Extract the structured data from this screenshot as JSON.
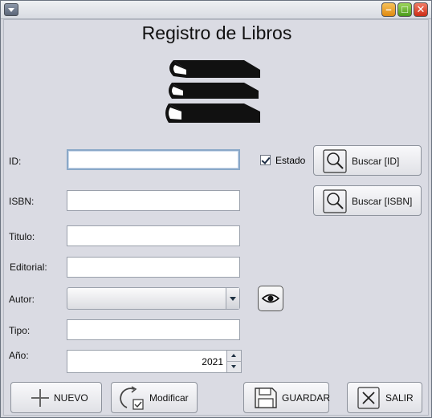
{
  "window": {
    "title": ""
  },
  "header": {
    "title": "Registro de Libros",
    "logo_icon": "books-icon"
  },
  "form": {
    "id": {
      "label": "ID:",
      "value": ""
    },
    "isbn": {
      "label": "ISBN:",
      "value": ""
    },
    "titulo": {
      "label": "Titulo:",
      "value": ""
    },
    "editorial": {
      "label": "Editorial:",
      "value": ""
    },
    "autor": {
      "label": "Autor:",
      "selected": ""
    },
    "tipo": {
      "label": "Tipo:",
      "value": ""
    },
    "anio": {
      "label": "Año:",
      "value": "2021"
    },
    "estado": {
      "label": "Estado",
      "checked": true
    }
  },
  "buttons": {
    "buscar_id": "Buscar [ID]",
    "buscar_isbn": "Buscar [ISBN]",
    "nuevo": "NUEVO",
    "modificar": "Modificar",
    "guardar": "GUARDAR",
    "salir": "SALIR"
  },
  "icons": {
    "search": "search-icon",
    "eye": "eye-icon",
    "plus": "plus-icon",
    "refresh": "refresh-icon",
    "save": "save-icon",
    "close": "close-icon"
  }
}
